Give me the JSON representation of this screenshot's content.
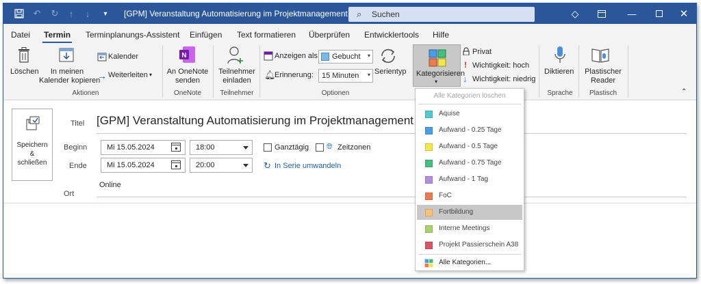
{
  "window": {
    "title": "[GPM] Veranstaltung Automatisierung im Projektmanagement  -  Ter...",
    "search_placeholder": "Suchen"
  },
  "tabs": [
    "Datei",
    "Termin",
    "Terminplanungs-Assistent",
    "Einfügen",
    "Text formatieren",
    "Überprüfen",
    "Entwicklertools",
    "Hilfe"
  ],
  "active_tab": "Termin",
  "ribbon": {
    "aktionen": {
      "label": "Aktionen",
      "loeschen": "Löschen",
      "kopieren_line1": "In meinen",
      "kopieren_line2": "Kalender kopieren",
      "kalender": "Kalender",
      "weiterleiten": "Weiterleiten"
    },
    "onenote": {
      "label": "OneNote",
      "line1": "An OneNote",
      "line2": "senden"
    },
    "teilnehmer": {
      "label": "Teilnehmer",
      "line1": "Teilnehmer",
      "line2": "einladen"
    },
    "optionen": {
      "label": "Optionen",
      "anzeigen_label": "Anzeigen als:",
      "anzeigen_value": "Gebucht",
      "erinnerung_label": "Erinnerung:",
      "erinnerung_value": "15 Minuten",
      "serientyp": "Serientyp"
    },
    "kategorien": {
      "label": "Kategorisieren",
      "privat": "Privat",
      "hoch": "Wichtigkeit: hoch",
      "niedrig": "Wichtigkeit: niedrig"
    },
    "sprache": {
      "label": "Sprache",
      "diktieren": "Diktieren"
    },
    "plastisch": {
      "label": "Plastisch",
      "line1": "Plastischer",
      "line2": "Reader"
    }
  },
  "form": {
    "save_line1": "Speichern",
    "save_line2": "&",
    "save_line3": "schließen",
    "titel_label": "Titel",
    "titel_value": "[GPM] Veranstaltung Automatisierung im Projektmanagement",
    "beginn_label": "Beginn",
    "beginn_date": "Mi 15.05.2024",
    "beginn_time": "18:00",
    "ende_label": "Ende",
    "ende_date": "Mi 15.05.2024",
    "ende_time": "20:00",
    "ganztaegig": "Ganztägig",
    "zeitzonen": "Zeitzonen",
    "serie": "In Serie umwandeln",
    "ort_label": "Ort",
    "ort_value": "Online"
  },
  "dropdown": {
    "clear_all": "Alle Kategorien löschen",
    "items": [
      {
        "label": "Aquise",
        "color": "#4fc9d2"
      },
      {
        "label": "Aufwand - 0.25 Tage",
        "color": "#4a9de6"
      },
      {
        "label": "Aufwand - 0.5 Tage",
        "color": "#f2e84a"
      },
      {
        "label": "Aufwand - 0.75 Tage",
        "color": "#43c07e"
      },
      {
        "label": "Aufwand - 1 Tag",
        "color": "#b08ee0"
      },
      {
        "label": "FoC",
        "color": "#ee7b50"
      },
      {
        "label": "Fortbildung",
        "color": "#f7c27a"
      },
      {
        "label": "Interne Meetings",
        "color": "#a8d36a"
      },
      {
        "label": "Projekt Passierschein A38",
        "color": "#dd5564"
      }
    ],
    "highlighted": "Fortbildung",
    "all_categories": "Alle Kategorien..."
  }
}
